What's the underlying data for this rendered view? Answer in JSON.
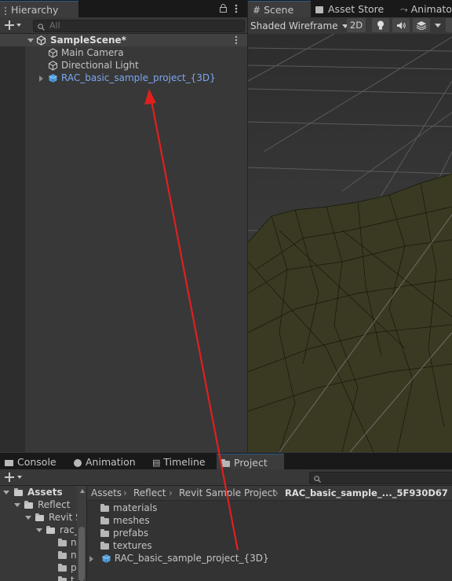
{
  "hierarchy": {
    "tab_label": "Hierarchy",
    "search_placeholder": "All",
    "scene_name": "SampleScene*",
    "items": [
      {
        "label": "Main Camera"
      },
      {
        "label": "Directional Light"
      },
      {
        "label": "RAC_basic_sample_project_{3D}"
      }
    ]
  },
  "scene_view": {
    "tabs": [
      {
        "label": "Scene"
      },
      {
        "label": "Asset Store"
      },
      {
        "label": "Animator"
      }
    ],
    "shading_mode": "Shaded Wireframe",
    "mode_2d_label": "2D"
  },
  "bottom_panel": {
    "tabs": [
      {
        "label": "Console"
      },
      {
        "label": "Animation"
      },
      {
        "label": "Timeline"
      },
      {
        "label": "Project"
      }
    ],
    "tree": [
      {
        "label": "Assets"
      },
      {
        "label": "Reflect"
      },
      {
        "label": "Revit S"
      },
      {
        "label": "rac_"
      },
      {
        "label": "n"
      },
      {
        "label": "n"
      },
      {
        "label": "p"
      },
      {
        "label": "t"
      }
    ],
    "breadcrumb": [
      {
        "label": "Assets"
      },
      {
        "label": "Reflect"
      },
      {
        "label": "Revit Sample Project"
      },
      {
        "label": "RAC_basic_sample_..._5F930D67"
      }
    ],
    "folder_items": [
      {
        "label": "materials"
      },
      {
        "label": "meshes"
      },
      {
        "label": "prefabs"
      },
      {
        "label": "textures"
      }
    ],
    "prefab_item": "RAC_basic_sample_project_{3D}"
  },
  "colors": {
    "accent_blue": "#7ba7f0",
    "annotation_red": "#e01f1f",
    "ground_olive": "#3a3a22"
  }
}
